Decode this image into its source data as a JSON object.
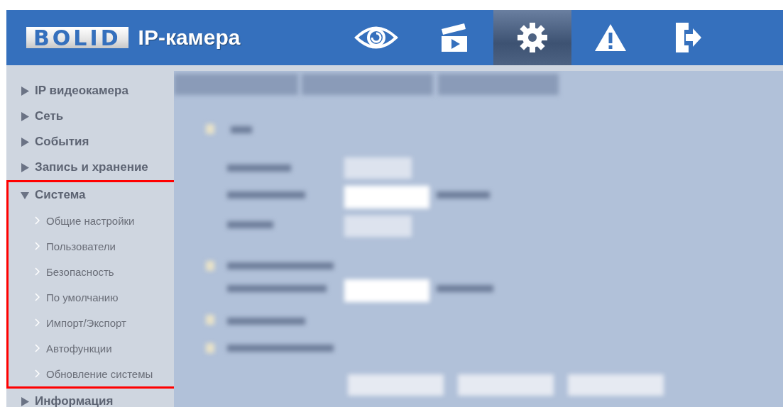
{
  "header": {
    "logo": "BOLID",
    "title": "IP-камера",
    "nav": [
      {
        "kind": "view",
        "selected": false
      },
      {
        "kind": "playback",
        "selected": false
      },
      {
        "kind": "settings",
        "selected": true
      },
      {
        "kind": "alarm",
        "selected": false
      },
      {
        "kind": "logout",
        "selected": false
      }
    ]
  },
  "sidebar": {
    "items": [
      {
        "label": "IP видеокамера",
        "expanded": false,
        "highlighted": false
      },
      {
        "label": "Сеть",
        "expanded": false,
        "highlighted": false
      },
      {
        "label": "События",
        "expanded": false,
        "highlighted": false
      },
      {
        "label": "Запись и хранение",
        "expanded": false,
        "highlighted": false
      },
      {
        "label": "Система",
        "expanded": true,
        "highlighted": true,
        "children": [
          {
            "label": "Общие настройки"
          },
          {
            "label": "Пользователи"
          },
          {
            "label": "Безопасность"
          },
          {
            "label": "По умолчанию"
          },
          {
            "label": "Импорт/Экспорт"
          },
          {
            "label": "Автофункции"
          },
          {
            "label": "Обновление системы"
          }
        ]
      },
      {
        "label": "Информация",
        "expanded": false,
        "highlighted": false
      }
    ]
  }
}
